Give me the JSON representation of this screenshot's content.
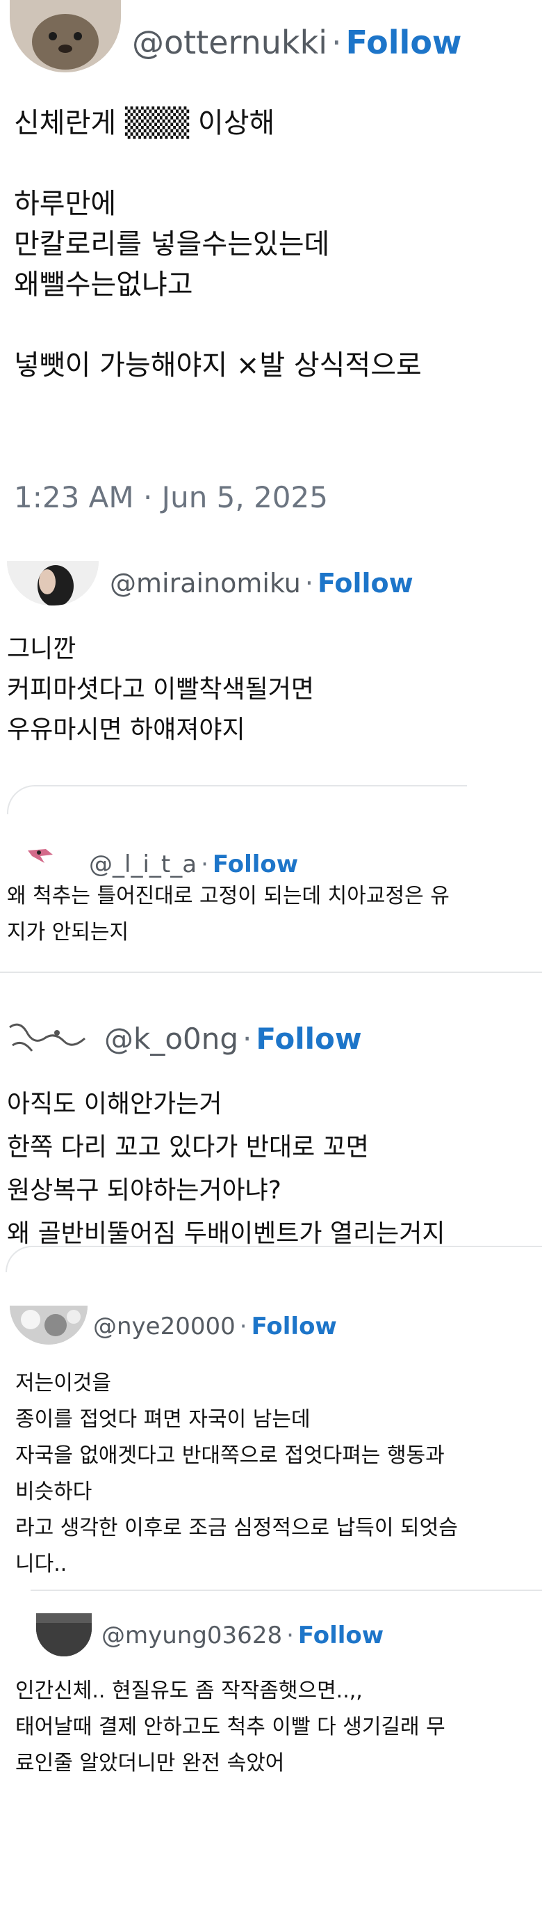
{
  "posts": [
    {
      "handle": "@otternukki",
      "follow": "Follow",
      "text": "신체란게 ▒▒▒ 이상해\n\n하루만에\n만칼로리를 넣을수는있는데\n왜뺄수는없냐고\n\n넣뺏이 가능해야지 ×발 상식적으로",
      "timestamp": "1:23 AM · Jun 5, 2025"
    },
    {
      "handle": "@mirainomiku",
      "follow": "Follow",
      "text": "그니깐\n커피마셧다고 이빨착색될거면\n우유마시면 하얘져야지"
    },
    {
      "handle": "@_l_i_t_a",
      "follow": "Follow",
      "text": "왜 척추는 틀어진대로 고정이 되는데 치아교정은 유\n지가 안되는지"
    },
    {
      "handle": "@k_o0ng",
      "follow": "Follow",
      "text": "아직도 이해안가는거\n한쪽 다리 꼬고 있다가 반대로 꼬면\n원상복구 되야하는거아냐?\n왜 골반비뚤어짐 두배이벤트가 열리는거지"
    },
    {
      "handle": "@nye20000",
      "follow": "Follow",
      "text": "저는이것을\n종이를 접엇다 펴면 자국이 남는데\n자국을 없애겟다고 반대쪽으로 접엇다펴는 행동과\n비슷하다\n라고 생각한 이후로 조금 심정적으로 납득이 되엇슴\n니다.."
    },
    {
      "handle": "@myung03628",
      "follow": "Follow",
      "text": "인간신체.. 현질유도 좀 작작좀햇으면..,,\n태어날때 결제 안하고도 척추 이빨 다 생기길래 무\n료인줄 알았더니만 완전 속았어"
    }
  ],
  "colors": {
    "follow": "#1d75c9",
    "handle": "#555b62",
    "text": "#111111",
    "timestamp": "#6b7480"
  }
}
